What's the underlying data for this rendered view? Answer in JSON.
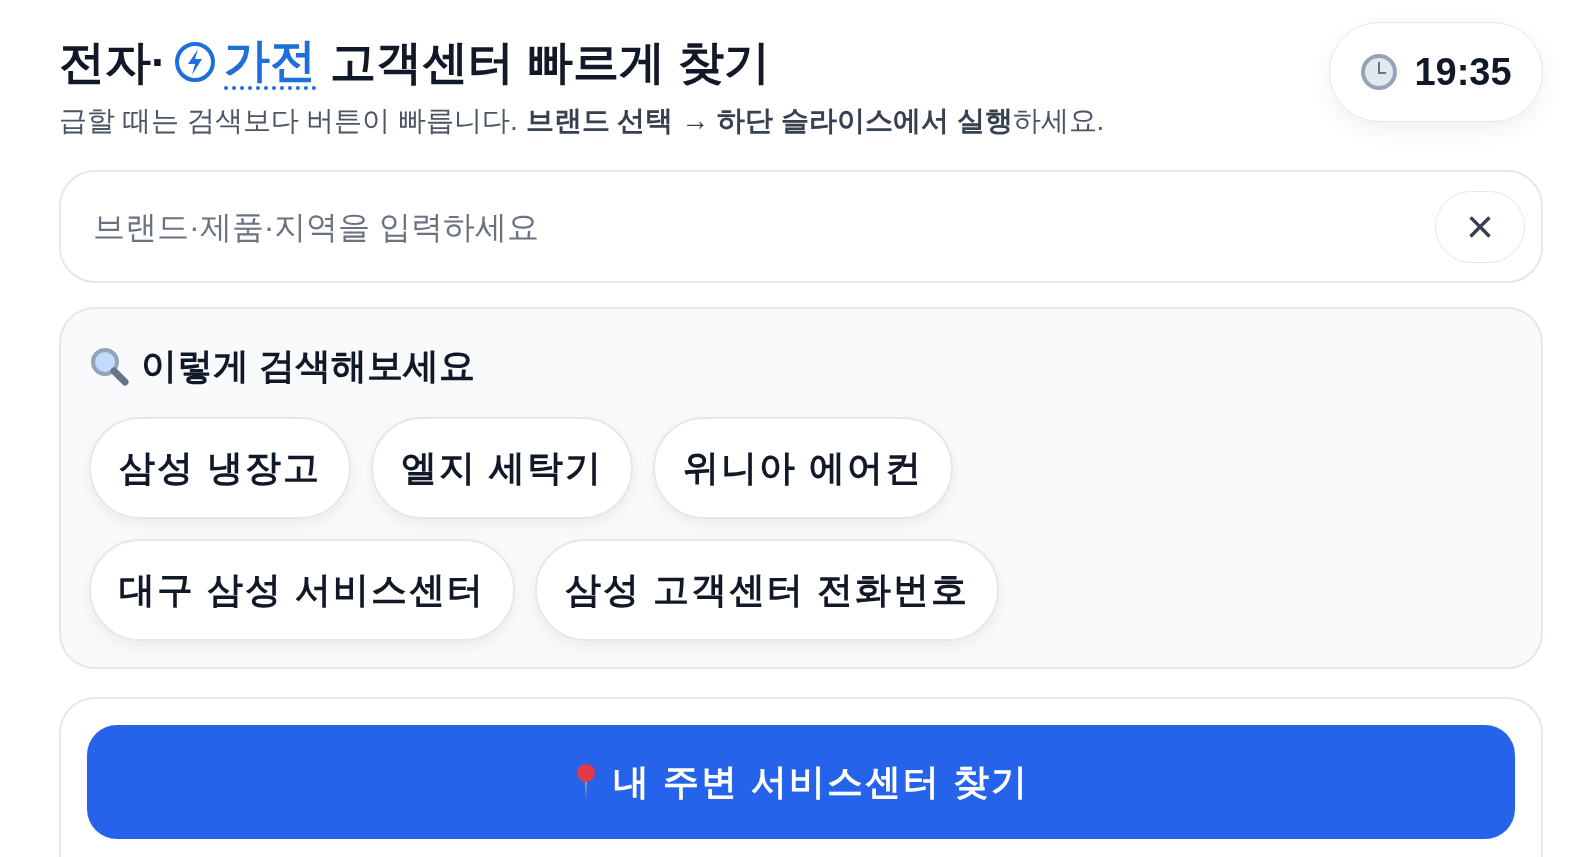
{
  "header": {
    "title_prefix": "전자·",
    "title_highlight": "가전",
    "title_suffix": "고객센터 빠르게 찾기",
    "subtitle": "급할 때는 검색보다 버튼이 빠릅니다. **브랜드 선택 → 하단 슬라이스에서 실행**하세요."
  },
  "clock": {
    "time": "19:35"
  },
  "search": {
    "placeholder": "브랜드·제품·지역을 입력하세요",
    "clear_label": "×"
  },
  "examples": {
    "title": "이렇게 검색해보세요",
    "chips": [
      "삼성 냉장고",
      "엘지 세탁기",
      "위니아 에어컨",
      "대구 삼성 서비스센터",
      "삼성 고객센터 전화번호"
    ]
  },
  "action": {
    "label": "내 주변 서비스센터 찾기"
  }
}
